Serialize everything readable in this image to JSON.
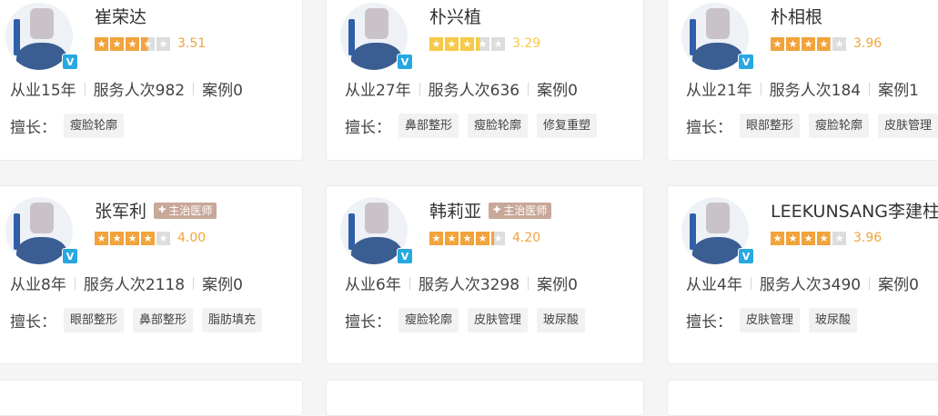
{
  "doctors": [
    {
      "name": "崔荣达",
      "title": "",
      "rating": 3.51,
      "score": "3.51",
      "score_color": "#f2a33b",
      "years": "从业15年",
      "served": "服务人次982",
      "cases": "案例0",
      "skills_label": "擅长：",
      "skills": [
        "瘦脸轮廓"
      ],
      "verified": "V"
    },
    {
      "name": "朴兴植",
      "title": "",
      "rating": 3.29,
      "score": "3.29",
      "score_color": "#f6c948",
      "years": "从业27年",
      "served": "服务人次636",
      "cases": "案例0",
      "skills_label": "擅长：",
      "skills": [
        "鼻部整形",
        "瘦脸轮廓",
        "修复重塑"
      ],
      "verified": "V"
    },
    {
      "name": "朴相根",
      "title": "",
      "rating": 3.96,
      "score": "3.96",
      "score_color": "#f2a33b",
      "years": "从业21年",
      "served": "服务人次184",
      "cases": "案例1",
      "skills_label": "擅长：",
      "skills": [
        "眼部整形",
        "瘦脸轮廓",
        "皮肤管理"
      ],
      "verified": "V"
    },
    {
      "name": "张军利",
      "title": "主治医师",
      "rating": 4.0,
      "score": "4.00",
      "score_color": "#f2a33b",
      "years": "从业8年",
      "served": "服务人次2118",
      "cases": "案例0",
      "skills_label": "擅长：",
      "skills": [
        "眼部整形",
        "鼻部整形",
        "脂肪填充"
      ],
      "verified": "V"
    },
    {
      "name": "韩莉亚",
      "title": "主治医师",
      "rating": 4.2,
      "score": "4.20",
      "score_color": "#f2a33b",
      "years": "从业6年",
      "served": "服务人次3298",
      "cases": "案例0",
      "skills_label": "擅长：",
      "skills": [
        "瘦脸轮廓",
        "皮肤管理",
        "玻尿酸"
      ],
      "verified": "V"
    },
    {
      "name": "LEEKUNSANG李建柱",
      "title": "",
      "rating": 3.96,
      "score": "3.96",
      "score_color": "#f2a33b",
      "years": "从业4年",
      "served": "服务人次3490",
      "cases": "案例0",
      "skills_label": "擅长：",
      "skills": [
        "皮肤管理",
        "玻尿酸"
      ],
      "verified": "V"
    }
  ],
  "colors": {
    "star_empty": "#dddddd",
    "title_tag": "#c8a899",
    "verified_badge": "#28a8e0"
  }
}
